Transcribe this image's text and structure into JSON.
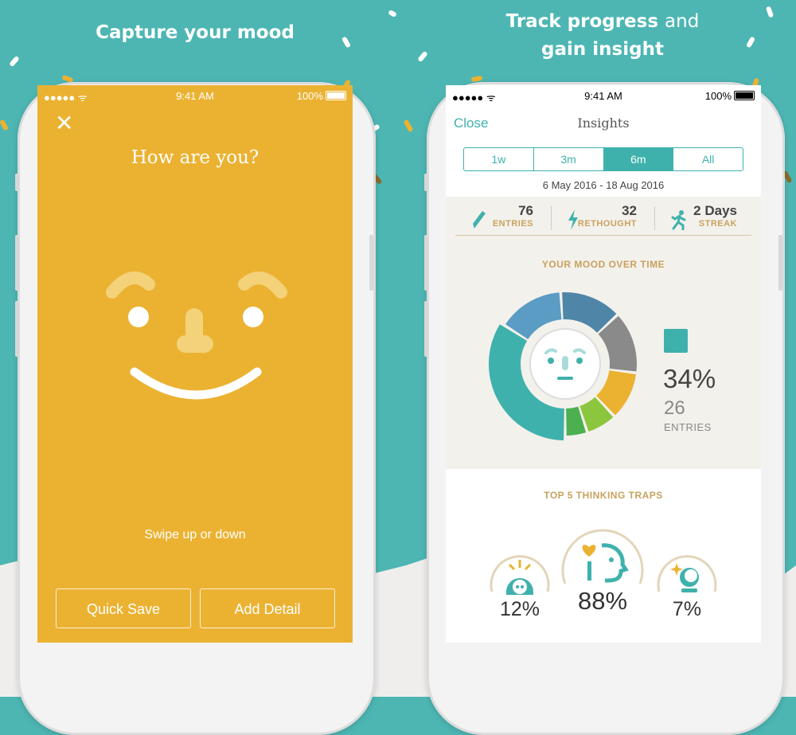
{
  "left": {
    "headline": "Capture your mood",
    "status": {
      "signal": "●●●●● ᯤ",
      "time": "9:41 AM",
      "battery": "100%"
    },
    "close_icon": "✕",
    "title": "How are you?",
    "swipe_hint": "Swipe up or down",
    "buttons": {
      "quick_save": "Quick Save",
      "add_detail": "Add Detail"
    },
    "colors": {
      "background": "#ebb232"
    }
  },
  "right": {
    "headline_bold1": "Track progress",
    "headline_light": "and",
    "headline_bold2": "gain insight",
    "status": {
      "signal": "●●●●● ᯤ",
      "time": "9:41 AM",
      "battery": "100%"
    },
    "nav": {
      "close": "Close",
      "title": "Insights"
    },
    "ranges": [
      {
        "label": "1w"
      },
      {
        "label": "3m"
      },
      {
        "label": "6m",
        "active": true
      },
      {
        "label": "All"
      }
    ],
    "date_range": "6 May 2016 - 18 Aug 2016",
    "stats": [
      {
        "value": "76",
        "label": "ENTRIES",
        "icon": "pencil-icon"
      },
      {
        "value": "32",
        "label": "RETHOUGHT",
        "icon": "lightning-icon"
      },
      {
        "value": "2 Days",
        "label": "STREAK",
        "icon": "runner-icon"
      }
    ],
    "mood_title": "YOUR MOOD OVER TIME",
    "mood_highlight": {
      "percent": "34%",
      "count": "26",
      "label": "ENTRIES",
      "color": "#3fb1ac"
    },
    "traps_title": "TOP 5 THINKING TRAPS",
    "traps": [
      {
        "percent": "12%",
        "icon": "mind-reading-icon"
      },
      {
        "percent": "88%",
        "icon": "heart-head-icon"
      },
      {
        "percent": "7%",
        "icon": "crystal-ball-icon"
      }
    ]
  },
  "chart_data": {
    "type": "pie",
    "title": "YOUR MOOD OVER TIME",
    "slices": [
      {
        "value": 34,
        "color": "#3fb1ac"
      },
      {
        "value": 15,
        "color": "#5b9cc4"
      },
      {
        "value": 14,
        "color": "#4f86a8"
      },
      {
        "value": 14,
        "color": "#8a8a8a"
      },
      {
        "value": 11,
        "color": "#ebb232"
      },
      {
        "value": 7,
        "color": "#8cc63f"
      },
      {
        "value": 5,
        "color": "#4caf50"
      }
    ]
  }
}
